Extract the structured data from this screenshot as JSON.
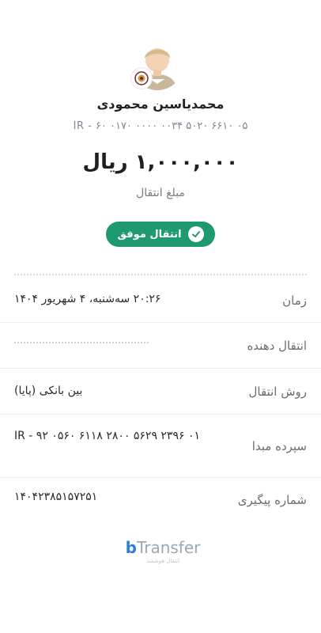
{
  "recipient": {
    "name": "محمدیاسین محمودی",
    "iban": "IR - ۶۰ ۰۱۷۰ ۰۰۰۰ ۰۰۳۴ ۵۰۲۰ ۶۶۱۰ ۰۵"
  },
  "amount": {
    "value": "۱,۰۰۰,۰۰۰ ریال",
    "label": "مبلغ انتقال"
  },
  "status": {
    "text": "انتقال موفق",
    "color": "#1f9a6f"
  },
  "details": {
    "time": {
      "label": "زمان",
      "value": "۲۰:۲۶ سه‌شنبه، ۴ شهریور ۱۴۰۴"
    },
    "sender": {
      "label": "انتقال دهنده"
    },
    "method": {
      "label": "روش انتقال",
      "value": "بین بانکی (پایا)"
    },
    "source": {
      "label": "سپرده مبدا",
      "value": "IR - ۹۲ ۰۵۶۰ ۶۱۱۸ ۲۸۰۰ ۵۶۲۹ ۲۳۹۶ ۰۱"
    },
    "tracking": {
      "label": "شماره پیگیری",
      "value": "۱۴۰۴۲۳۸۵۱۵۷۲۵۱"
    }
  },
  "logo": {
    "brand_b": "b",
    "brand_rest": "Transfer",
    "sub": "انتقال هوشمند"
  },
  "icons": {
    "avatar": "user-avatar",
    "bank": "bank-logo-icon",
    "status": "check-circle-icon"
  }
}
